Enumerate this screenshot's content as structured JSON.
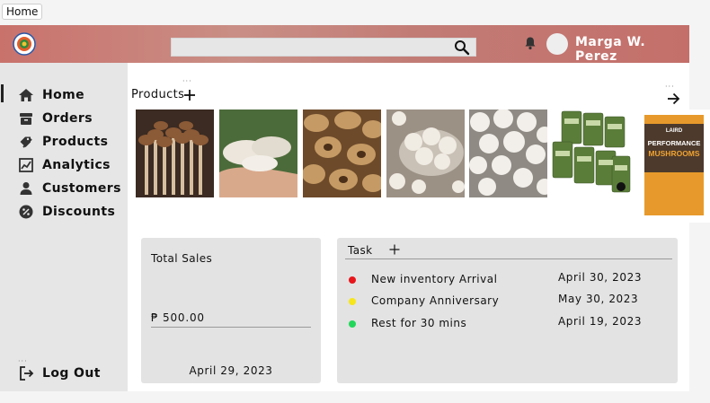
{
  "browser_tab": {
    "label": "Home"
  },
  "header": {
    "search": {
      "placeholder": "",
      "value": ""
    },
    "user_name": "Marga W. Perez"
  },
  "sidebar": {
    "items": [
      {
        "label": "Home",
        "icon": "home-icon",
        "active": true
      },
      {
        "label": "Orders",
        "icon": "box-icon"
      },
      {
        "label": "Products",
        "icon": "tag-icon"
      },
      {
        "label": "Analytics",
        "icon": "chart-icon"
      },
      {
        "label": "Customers",
        "icon": "person-icon"
      },
      {
        "label": "Discounts",
        "icon": "percent-badge-icon"
      }
    ],
    "logout_label": "Log Out"
  },
  "products": {
    "title": "Products",
    "images": [
      {
        "name": "beech-mushrooms-image"
      },
      {
        "name": "oyster-mushrooms-image"
      },
      {
        "name": "dried-shiitake-image"
      },
      {
        "name": "white-button-mushrooms-bowl-image"
      },
      {
        "name": "white-button-mushrooms-image"
      },
      {
        "name": "mushroom-snack-packs-image"
      },
      {
        "name": "performance-mushrooms-bag-image",
        "package_text": [
          "LAIRD",
          "PERFORMANCE",
          "MUSHROOMS"
        ]
      }
    ]
  },
  "total_sales": {
    "title": "Total Sales",
    "value": "₱ 500.00",
    "date": "April 29, 2023"
  },
  "tasks": {
    "title": "Task",
    "items": [
      {
        "name": "New inventory Arrival",
        "date": "April 30, 2023",
        "color": "#e8161b"
      },
      {
        "name": "Company Anniversary",
        "date": "May 30, 2023",
        "color": "#f6e61b"
      },
      {
        "name": "Rest for 30 mins",
        "date": "April 19, 2023",
        "color": "#22d65a"
      }
    ]
  },
  "colors": {
    "header": "#c9786f",
    "sidebar": "#e6e6e6",
    "card": "#e3e3e3"
  }
}
